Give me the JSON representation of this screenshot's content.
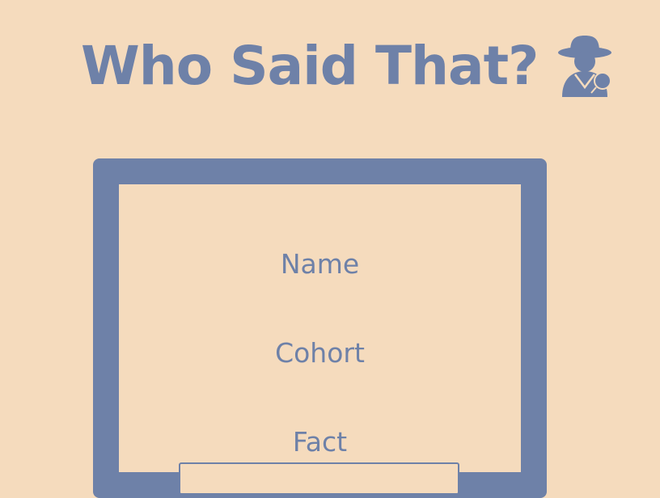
{
  "header": {
    "title": "Who Said That?",
    "icon": "detective-icon"
  },
  "form": {
    "labels": {
      "name": "Name",
      "cohort": "Cohort",
      "fact": "Fact"
    }
  },
  "colors": {
    "background": "#f5dbbd",
    "accent": "#6e81a8"
  }
}
